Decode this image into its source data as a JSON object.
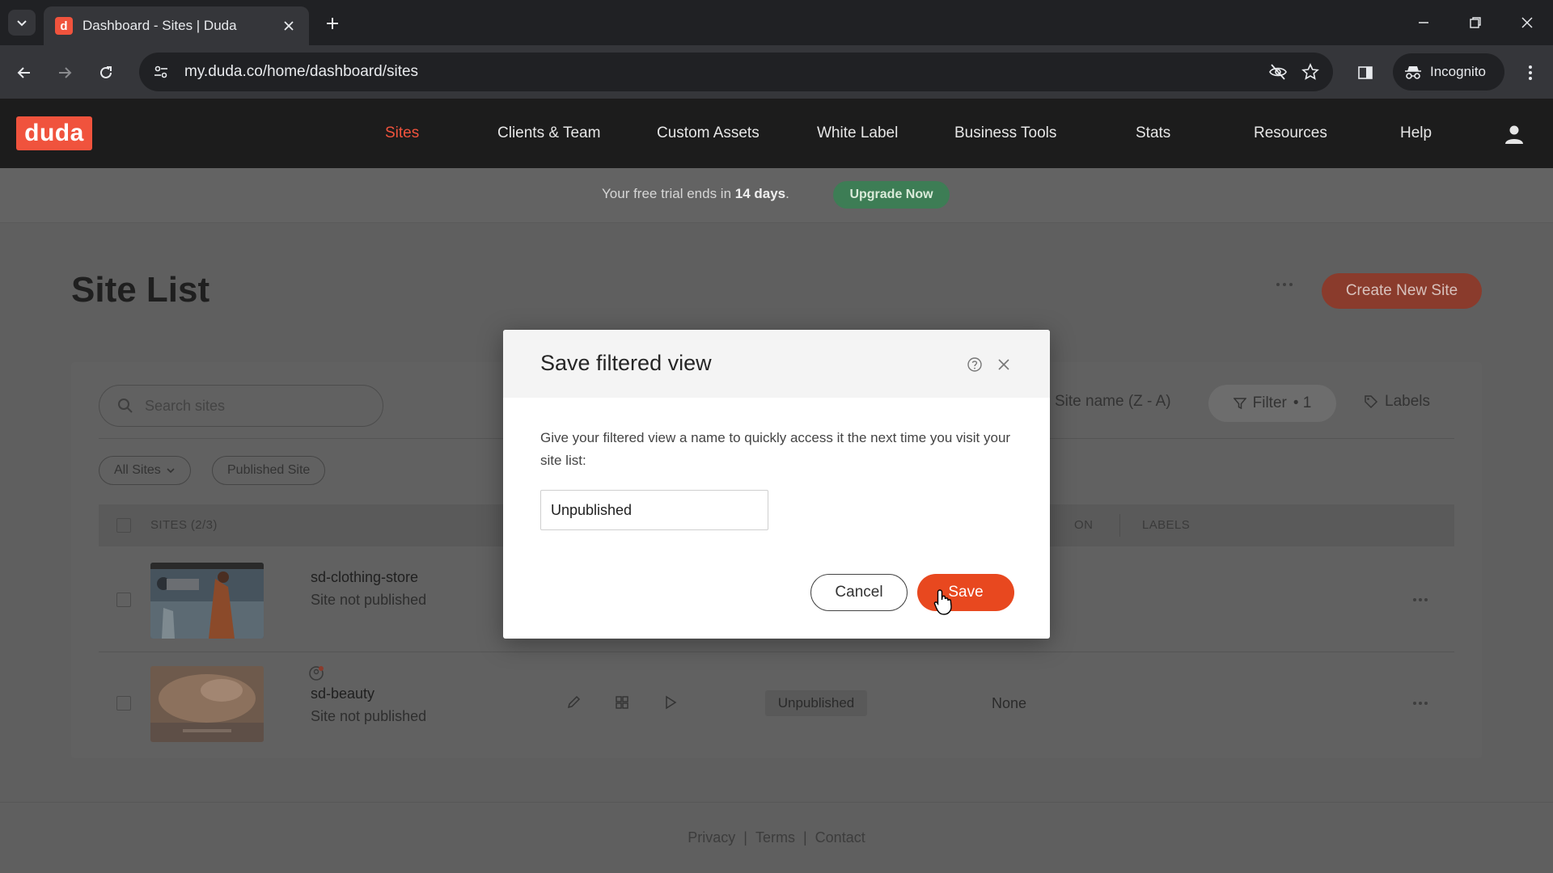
{
  "browser": {
    "tab_title": "Dashboard - Sites | Duda",
    "tab_favicon_letter": "d",
    "url": "my.duda.co/home/dashboard/sites",
    "incognito_label": "Incognito"
  },
  "app": {
    "logo_text": "duda",
    "nav": [
      {
        "label": "Sites",
        "active": true
      },
      {
        "label": "Clients & Team"
      },
      {
        "label": "Custom Assets"
      },
      {
        "label": "White Label"
      },
      {
        "label": "Business Tools"
      },
      {
        "label": "Stats"
      },
      {
        "label": "Resources"
      },
      {
        "label": "Help"
      }
    ]
  },
  "trial": {
    "text_prefix": "Your free trial ends in ",
    "days": "14 days",
    "text_suffix": ".",
    "upgrade_label": "Upgrade Now"
  },
  "page": {
    "title": "Site List",
    "create_label": "Create New Site"
  },
  "list": {
    "search_placeholder": "Search sites",
    "sort_label": "Site name (Z - A)",
    "filter_label": "Filter",
    "filter_count": "• 1",
    "labels_label": "Labels",
    "chip_all": "All Sites",
    "chip_published": "Published Site",
    "col_sites": "SITES (2/3)",
    "col_on": "ON",
    "col_labels": "LABELS",
    "rows": [
      {
        "name": "sd-clothing-store",
        "status": "Site not published"
      },
      {
        "name": "sd-beauty",
        "status": "Site not published",
        "publication": "Unpublished",
        "labels": "None"
      }
    ]
  },
  "footer": {
    "privacy": "Privacy",
    "terms": "Terms",
    "contact": "Contact",
    "sep": "|"
  },
  "modal": {
    "title": "Save filtered view",
    "description": "Give your filtered view a name to quickly access it the next time you visit your site list:",
    "input_value": "Unpublished",
    "cancel_label": "Cancel",
    "save_label": "Save"
  },
  "colors": {
    "brand": "#f0533d",
    "save": "#e8481f",
    "upgrade": "#3d7d55"
  }
}
